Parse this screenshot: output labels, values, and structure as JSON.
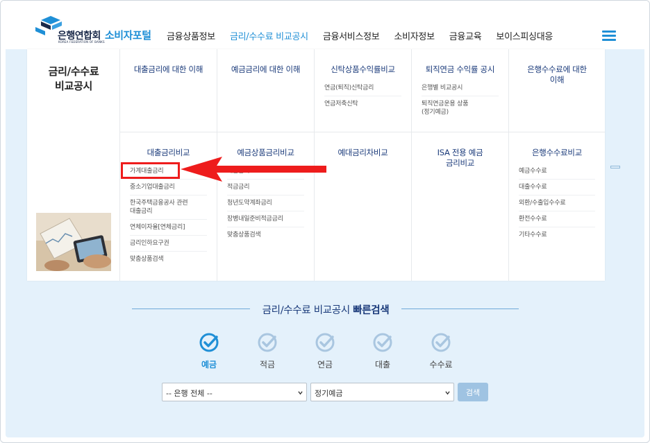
{
  "header": {
    "logo_org": "은행연합회",
    "logo_org_en": "KOREA FEDERATION OF BANKS",
    "logo_portal": "소비자포털",
    "gnb": [
      {
        "label": "금융상품정보"
      },
      {
        "label": "금리/수수료 비교공시"
      },
      {
        "label": "금융서비스정보"
      },
      {
        "label": "소비자정보"
      },
      {
        "label": "금융교육"
      },
      {
        "label": "보이스피싱대응"
      }
    ],
    "active_gnb": 1
  },
  "mega_menu": {
    "title": "금리/수수료\n비교공시",
    "row1": [
      {
        "title": "대출금리에 대한 이해",
        "items": []
      },
      {
        "title": "예금금리에 대한 이해",
        "items": []
      },
      {
        "title": "신탁상품수익률비교",
        "items": [
          "연금(퇴직)신탁금리",
          "연금저축신탁"
        ]
      },
      {
        "title": "퇴직연금 수익률 공시",
        "items": [
          "은행별 비교공시",
          "퇴직연금운용 상품\n(정기예금)"
        ]
      },
      {
        "title": "은행수수료에 대한\n이해",
        "items": []
      }
    ],
    "row2": [
      {
        "title": "대출금리비교",
        "items": [
          "가계대출금리",
          "중소기업대출금리",
          "한국주택금융공사 관련\n대출금리",
          "연체이자율[연체금리]",
          "금리인하요구권",
          "맞춤상품검색"
        ]
      },
      {
        "title": "예금상품금리비교",
        "items": [
          "예금금리",
          "적금금리",
          "청년도약계좌금리",
          "장병내일준비적금금리",
          "맞춤상품검색"
        ]
      },
      {
        "title": "예대금리차비교",
        "items": []
      },
      {
        "title": "ISA 전용 예금\n금리비교",
        "items": []
      },
      {
        "title": "은행수수료비교",
        "items": [
          "예금수수료",
          "대출수수료",
          "외환/수출입수수료",
          "환전수수료",
          "기타수수료"
        ]
      }
    ]
  },
  "quick_search": {
    "title_prefix": "금리/수수료 비교공시",
    "title_bold": "빠른검색",
    "tabs": [
      {
        "label": "예금"
      },
      {
        "label": "적금"
      },
      {
        "label": "연금"
      },
      {
        "label": "대출"
      },
      {
        "label": "수수료"
      }
    ],
    "active_tab": 0,
    "bank_select": "-- 은행 전체 --",
    "product_select": "정기예금",
    "search_label": "검색"
  },
  "colors": {
    "accent": "#1f8fd6",
    "navy": "#1a3a7a",
    "highlight": "#ee1c1c",
    "sky": "#e4f1fb"
  }
}
